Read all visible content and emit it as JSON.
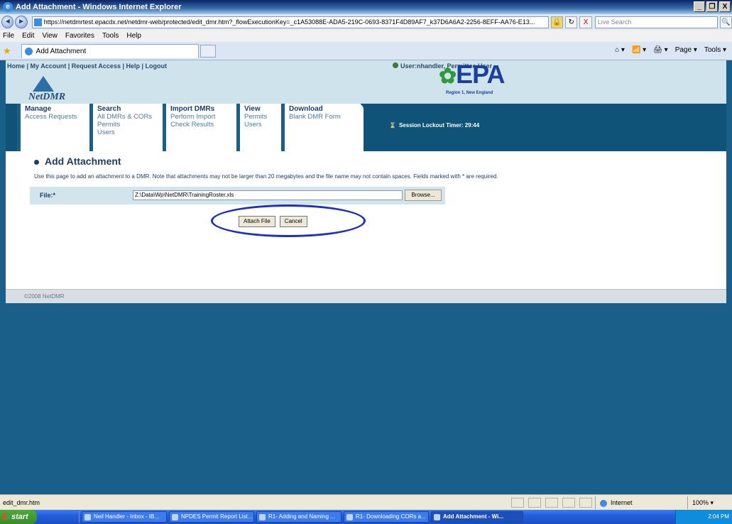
{
  "window": {
    "title": "Add Attachment - Windows Internet Explorer",
    "controls": [
      "_",
      "❐",
      "X"
    ]
  },
  "browser": {
    "back_glyph": "◄",
    "forward_glyph": "►",
    "url": "https://netdmrtest.epacdx.net/netdmr-web/protected/edit_dmr.htm?_flowExecutionKey=_c1A53088E-ADA5-219C-0693-8371F4D89AF7_k37D6A6A2-2256-8EFF-AA76-E13...",
    "lock_glyph": "🔒",
    "refresh_glyph": "↻",
    "stop_glyph": "X",
    "search_placeholder": "Live Search",
    "search_glyph": "🔍",
    "menu": [
      "File",
      "Edit",
      "View",
      "Favorites",
      "Tools",
      "Help"
    ],
    "star_glyph": "★",
    "tab_label": "Add Attachment",
    "command_bar": [
      "⌂ ▾",
      "📶 ▾",
      "🖨 ▾",
      "Page ▾",
      "Tools ▾"
    ]
  },
  "header": {
    "nav": [
      "Home",
      "My Account",
      "Request Access",
      "Help",
      "Logout"
    ],
    "nav_separator": " | ",
    "user": "User:nhandler, Permittee User",
    "logo_text": "NetDMR",
    "epa_mark": "✿",
    "epa_text": "EPA",
    "epa_region": "Region 1, New England"
  },
  "menu": {
    "columns": [
      {
        "heading": "Manage",
        "items": [
          "Access Requests"
        ]
      },
      {
        "heading": "Search",
        "items": [
          "All DMRs & CORs",
          "Permits",
          "Users"
        ]
      },
      {
        "heading": "Import DMRs",
        "items": [
          "Perform Import",
          "Check Results"
        ]
      },
      {
        "heading": "View",
        "items": [
          "Permits",
          "Users"
        ]
      },
      {
        "heading": "Download",
        "items": [
          "Blank DMR Form"
        ]
      }
    ],
    "lockout_icon": "⌛",
    "lockout_label": "Session Lockout Timer: 29:44"
  },
  "main": {
    "title": "Add Attachment",
    "instructions": "Use this page to add an attachment to a DMR. Note that attachments may not be larger than 20 megabytes and the file name may not contain spaces. Fields marked with * are required.",
    "file_label": "File:*",
    "file_value": "Z:\\Data\\Wp\\NetDMR\\TrainingRoster.xls",
    "browse_label": "Browse...",
    "attach_label": "Attach File",
    "cancel_label": "Cancel"
  },
  "footer": {
    "copyright": "©2008 NetDMR"
  },
  "status": {
    "text": "edit_dmr.htm",
    "zone": "Internet",
    "zoom": "100% ▾"
  },
  "taskbar": {
    "start": "start",
    "tasks": [
      "Neil Handler - Inbox - IB...",
      "NPDES Permit Report List...",
      "R1- Adding and Naming ...",
      "R1- Downloading CORs a...",
      "Add Attachment - Wi..."
    ],
    "clock": "2:04 PM"
  },
  "colors": {
    "page_bg": "#1a5f8a",
    "menu_band": "#0f5378",
    "highlight_oval": "#1c2dc8",
    "heading": "#1d3e6b"
  }
}
